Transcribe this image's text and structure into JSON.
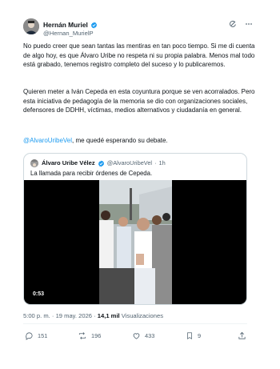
{
  "author": {
    "name": "Hernán Muriel",
    "handle": "@Hernan_MurielP"
  },
  "body": {
    "p1": "No puedo creer que sean tantas las mentiras en tan poco tiempo. Si me di cuenta de algo hoy, es que Álvaro Uribe no respeta ni su propia palabra. Menos mal todo está grabado, tenemos registro completo del suceso y lo publicaremos.",
    "p2": "Quieren meter a Iván Cepeda en esta coyuntura porque se ven acorralados. Pero esta iniciativa de pedagogía de la memoria se dio con organizaciones sociales, defensores de DDHH, víctimas, medios alternativos y ciudadanía en general.",
    "p3_mention": "@AlvaroUribeVel",
    "p3_rest": ", me quedé esperando su debate."
  },
  "quote": {
    "name": "Álvaro Uribe Vélez",
    "handle": "@AlvaroUribeVel",
    "separator": "·",
    "time": "1h",
    "text": "La llamada para recibir órdenes de Cepeda.",
    "video_duration": "0:53"
  },
  "meta": {
    "time": "5:00 p. m.",
    "dot": "·",
    "date": "19 may. 2026",
    "views_count": "14,1 mil",
    "views_label": "Visualizaciones"
  },
  "actions": {
    "replies": "151",
    "reposts": "196",
    "likes": "433",
    "bookmarks": "9"
  },
  "colors": {
    "accent": "#1d9bf0",
    "text": "#0f1419",
    "muted": "#536471",
    "border": "#cfd9de"
  },
  "icons": {
    "verified": "verified-badge-icon",
    "grok": "grok-icon",
    "more": "more-icon",
    "reply": "reply-icon",
    "repost": "repost-icon",
    "like": "heart-icon",
    "bookmark": "bookmark-icon",
    "share": "share-icon"
  }
}
